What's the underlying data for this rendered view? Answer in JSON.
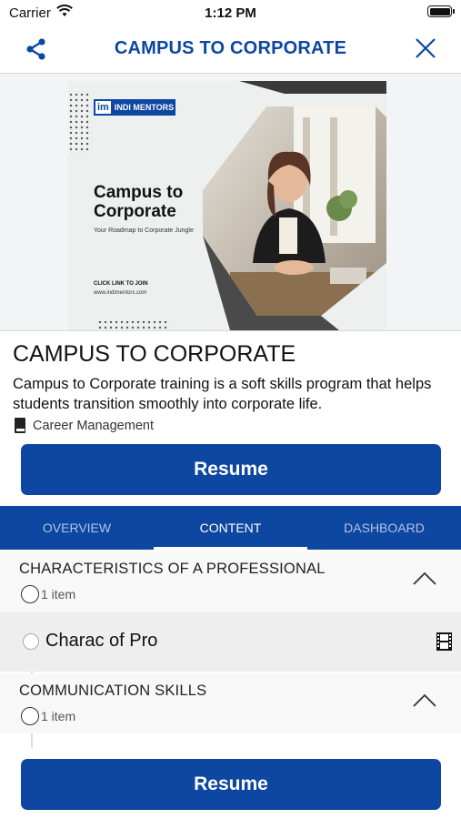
{
  "status_bar": {
    "carrier": "Carrier",
    "time": "1:12 PM"
  },
  "nav": {
    "title": "CAMPUS TO CORPORATE",
    "share_icon": "share-icon",
    "close_icon": "close-icon"
  },
  "banner": {
    "logo_im": "im",
    "logo_text": "INDI MENTORS",
    "heading_line1": "Campus to",
    "heading_line2": "Corporate",
    "subheading": "Your Roadmap to Corporate Jungle",
    "cta": "CLICK LINK TO JOIN",
    "url": "www.indimentors.com"
  },
  "course": {
    "title": "CAMPUS TO CORPORATE",
    "description": "Campus to Corporate training is a soft skills program that helps students transition smoothly into corporate life.",
    "category": "Career Management"
  },
  "buttons": {
    "resume": "Resume"
  },
  "tabs": [
    {
      "label": "OVERVIEW",
      "active": false
    },
    {
      "label": "CONTENT",
      "active": true
    },
    {
      "label": "DASHBOARD",
      "active": false
    }
  ],
  "sections": [
    {
      "title": "CHARACTERISTICS OF A PROFESSIONAL",
      "count": "1 item",
      "expanded": true,
      "lessons": [
        {
          "title": "Charac of Pro",
          "icon": "film-icon"
        }
      ]
    },
    {
      "title": "COMMUNICATION SKILLS",
      "count": "1 item",
      "expanded": true,
      "lessons": []
    }
  ],
  "colors": {
    "primary": "#0d47a1",
    "tab_inactive": "#b3c3e0"
  }
}
